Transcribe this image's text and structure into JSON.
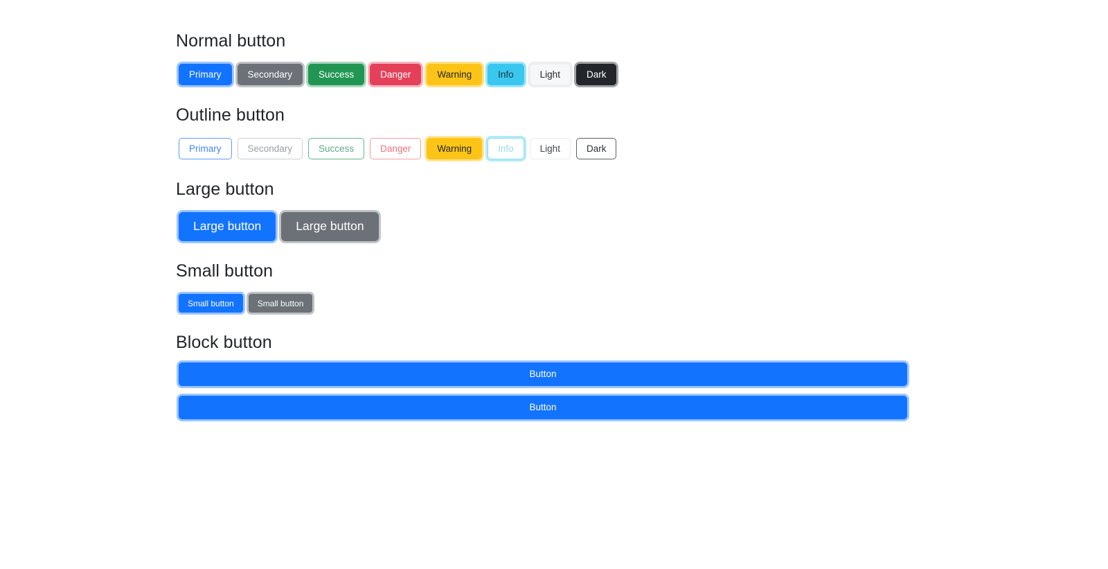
{
  "sections": [
    {
      "id": "normal",
      "heading": "Normal button",
      "buttons": [
        {
          "label": "Primary",
          "variant": "primary",
          "color": "#1273ff",
          "focused": true
        },
        {
          "label": "Secondary",
          "variant": "secondary",
          "color": "#6b7177",
          "focused": true
        },
        {
          "label": "Success",
          "variant": "success",
          "color": "#219653",
          "focused": true
        },
        {
          "label": "Danger",
          "variant": "danger",
          "color": "#e4405a",
          "focused": true
        },
        {
          "label": "Warning",
          "variant": "warning",
          "color": "#fcc417",
          "focused": true
        },
        {
          "label": "Info",
          "variant": "info",
          "color": "#3ac7ef",
          "focused": true
        },
        {
          "label": "Light",
          "variant": "light",
          "color": "#f6f7f8",
          "focused": true
        },
        {
          "label": "Dark",
          "variant": "dark",
          "color": "#22262a",
          "focused": true
        }
      ]
    },
    {
      "id": "outline",
      "heading": "Outline button",
      "buttons": [
        {
          "label": "Primary",
          "variant": "o-primary",
          "color": "#3d87fb",
          "focused": false
        },
        {
          "label": "Secondary",
          "variant": "o-secondary",
          "color": "#9aa0a6",
          "focused": false
        },
        {
          "label": "Success",
          "variant": "o-success",
          "color": "#5fa985",
          "focused": false
        },
        {
          "label": "Danger",
          "variant": "o-danger",
          "color": "#f4707f",
          "focused": false
        },
        {
          "label": "Warning",
          "variant": "o-warning",
          "color": "#fcc417",
          "focused": true,
          "state": "hover"
        },
        {
          "label": "Info",
          "variant": "o-info",
          "color": "#9adbee",
          "focused": true
        },
        {
          "label": "Light",
          "variant": "o-light",
          "color": "#44484c",
          "focused": false
        },
        {
          "label": "Dark",
          "variant": "o-dark",
          "color": "#2c3135",
          "focused": false
        }
      ]
    },
    {
      "id": "large",
      "heading": "Large button",
      "buttons": [
        {
          "label": "Large button",
          "variant": "primary",
          "color": "#1273ff",
          "size": "lg",
          "focused": true
        },
        {
          "label": "Large button",
          "variant": "secondary",
          "color": "#6b7177",
          "size": "lg",
          "focused": true
        }
      ]
    },
    {
      "id": "small",
      "heading": "Small button",
      "buttons": [
        {
          "label": "Small button",
          "variant": "primary",
          "color": "#1273ff",
          "size": "sm",
          "focused": true
        },
        {
          "label": "Small button",
          "variant": "secondary",
          "color": "#6b7177",
          "size": "sm",
          "focused": true
        }
      ]
    },
    {
      "id": "block",
      "heading": "Block button",
      "buttons": [
        {
          "label": "Button",
          "variant": "primary",
          "color": "#1273ff",
          "block": true,
          "focused": true
        },
        {
          "label": "Button",
          "variant": "primary",
          "color": "#1273ff",
          "block": true,
          "focused": true
        }
      ]
    }
  ],
  "palette": {
    "primary": "#1273ff",
    "secondary": "#6b7177",
    "success": "#219653",
    "danger": "#e4405a",
    "warning": "#fcc417",
    "info": "#3ac7ef",
    "light": "#f6f7f8",
    "dark": "#22262a",
    "page_background": "#ffffff",
    "heading_text": "#212529"
  }
}
